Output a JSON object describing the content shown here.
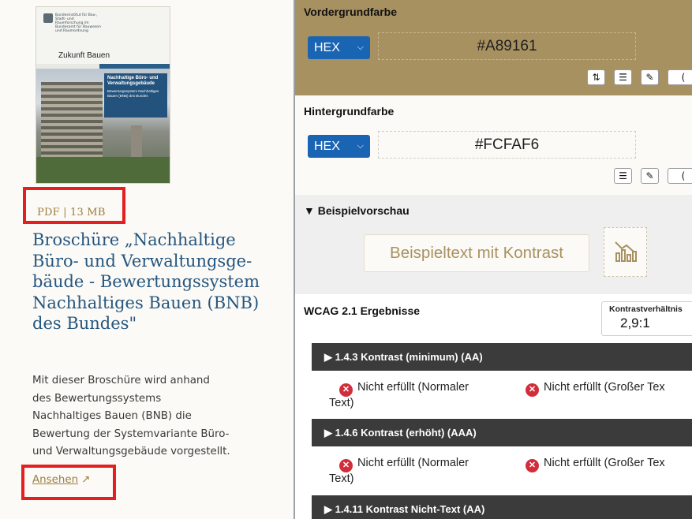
{
  "left": {
    "cover": {
      "org": "Bundesinstitut für Bau-, Stadt- und Raumforschung im Bundesamt für Bauwesen und Raumordnung",
      "series": "Zukunft Bauen",
      "series_sub": "Forschung für die Praxis | Band 11",
      "title": "Nachhaltige Büro- und Verwaltungsgebäude",
      "subtitle": "Bewertungssystem Nachhaltiges Bauen (BNB) des Bundes"
    },
    "meta": "PDF | 13 MB",
    "title_lines": [
      "Broschüre „Nachhaltige",
      "Büro- und Verwaltungsge-",
      "bäude - Bewertungssystem",
      "Nachhaltiges Bauen (BNB)",
      "des Bundes\""
    ],
    "desc_lines": [
      "Mit dieser Broschüre wird anhand",
      "des Bewertungssystems",
      "Nachhaltiges Bauen (BNB) die",
      "Bewertung der Systemvariante Büro-",
      "und Verwaltungsgebäude vorgestellt."
    ],
    "link_label": "Ansehen",
    "link_icon": "↗",
    "colors": {
      "accent": "#9b7d3f",
      "title": "#25567f",
      "highlight": "#e31f1f"
    }
  },
  "right": {
    "foreground": {
      "label": "Vordergrundfarbe",
      "format": "HEX",
      "value": "#A89161",
      "color": "#a89161",
      "icons": [
        "swap-icon",
        "sliders-icon",
        "eyedropper-icon"
      ]
    },
    "background": {
      "label": "Hintergrundfarbe",
      "format": "HEX",
      "value": "#FCFAF6",
      "color": "#fcfaf6",
      "icons": [
        "sliders-icon",
        "eyedropper-icon"
      ]
    },
    "preview": {
      "heading": "▼ Beispielvorschau",
      "sample_text": "Beispieltext mit Kontrast",
      "chart_icon": "chart-icon"
    },
    "wcag": {
      "heading": "WCAG 2.1 Ergebnisse",
      "ratio_label": "Kontrastverhältnis",
      "ratio_value": "2,9:1",
      "criteria": [
        {
          "title": "▶ 1.4.3 Kontrast (minimum) (AA)",
          "normal": [
            "Nicht erfüllt (Normaler",
            "Text)"
          ],
          "large": "Nicht erfüllt (Großer Tex"
        },
        {
          "title": "▶ 1.4.6 Kontrast (erhöht) (AAA)",
          "normal": [
            "Nicht erfüllt (Normaler",
            "Text)"
          ],
          "large": "Nicht erfüllt (Großer Tex"
        },
        {
          "title": "▶ 1.4.11 Kontrast Nicht-Text (AA)"
        }
      ]
    }
  }
}
